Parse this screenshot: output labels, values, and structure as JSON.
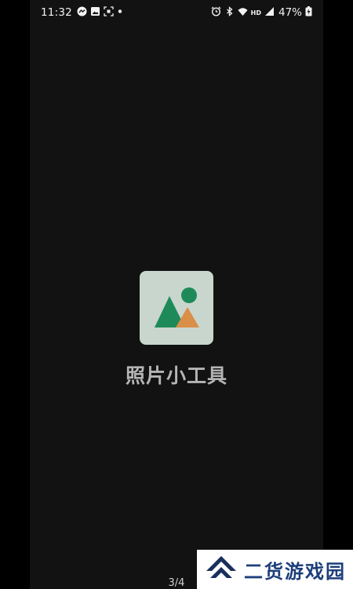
{
  "status_bar": {
    "time": "11:32",
    "battery_percent": "47%",
    "left_icons": [
      "messenger-icon",
      "gallery-icon",
      "screenshot-icon",
      "notification-dot-icon"
    ],
    "right_icons": [
      "alarm-icon",
      "bluetooth-icon",
      "wifi-icon",
      "hd-icon",
      "signal-icon",
      "battery-charging-icon"
    ],
    "hd_label": "HD"
  },
  "app": {
    "name": "照片小工具",
    "icon": "photo-landscape-icon",
    "colors": {
      "icon_bg": "#c9d6cd",
      "green": "#1e8a5a",
      "orange": "#d98f48"
    }
  },
  "pager": {
    "label": "3/4"
  },
  "watermark": {
    "text": "二货游戏园"
  }
}
